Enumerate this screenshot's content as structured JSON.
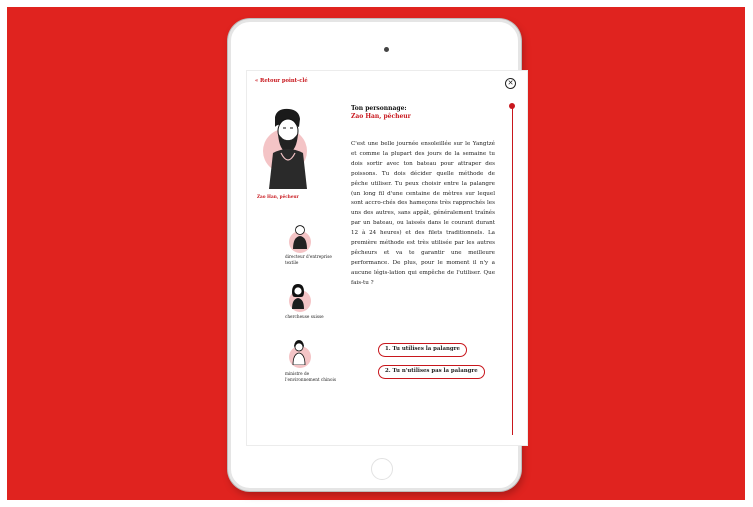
{
  "colors": {
    "brand_red": "#c8171d",
    "background_red": "#e0231f",
    "accent_pink": "#f4c4c6"
  },
  "nav": {
    "back_label": "« Retour point-clé",
    "close_icon": "close-icon"
  },
  "character": {
    "heading": "Ton personnage:",
    "name": "Zao Han, pêcheur",
    "portrait_label": "Zao Han, pêcheur"
  },
  "other_characters": [
    {
      "label": "directeur d'entreprise textile"
    },
    {
      "label": "chercheuse suisse"
    },
    {
      "label": "ministre de l'environnement chinois"
    }
  ],
  "story": {
    "text": "C'est une belle journée ensoleillée sur le Yangtzé et comme la plupart des jours de la semaine tu dois sortir avec ton bateau pour attraper des poissons. Tu dois décider quelle méthode de pêche utiliser. Tu peux choisir entre la palangre (un long fil d'une centaine de mètres sur lequel sont accro-chés des hameçons très rapprochés les uns des autres, sans appât, généralement traînés par un bateau, ou laissés dans le courant durant 12 à 24 heures) et des filets traditionnels. La première méthode est très utilisée par les autres pêcheurs et va te garantir une meilleure performance. De plus, pour le moment il n'y a aucune légis-lation qui empêche de l'utiliser. Que fais-tu ?"
  },
  "choices": [
    {
      "label": "1. Tu utilises la palangre"
    },
    {
      "label": "2. Tu n'utilises pas la palangre"
    }
  ]
}
